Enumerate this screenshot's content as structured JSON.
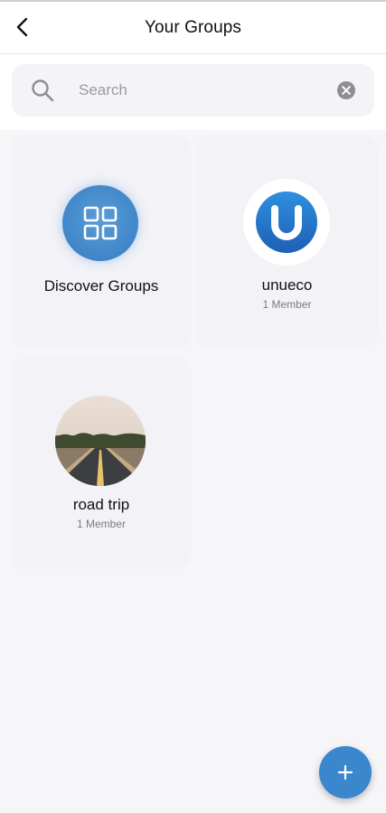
{
  "header": {
    "title": "Your Groups",
    "back_icon": "chevron-left-icon"
  },
  "search": {
    "placeholder": "Search",
    "value": "",
    "search_icon": "magnifier-icon",
    "clear_icon": "clear-circle-icon"
  },
  "groups": [
    {
      "name": "Discover Groups",
      "members": "",
      "icon": "grid-icon",
      "accent": "#3f86c9"
    },
    {
      "name": "unueco",
      "members": "1 Member",
      "icon": "unueco-logo"
    },
    {
      "name": "road trip",
      "members": "1 Member",
      "icon": "road-photo"
    }
  ],
  "fab": {
    "icon": "plus-icon",
    "color": "#3a87cd"
  }
}
